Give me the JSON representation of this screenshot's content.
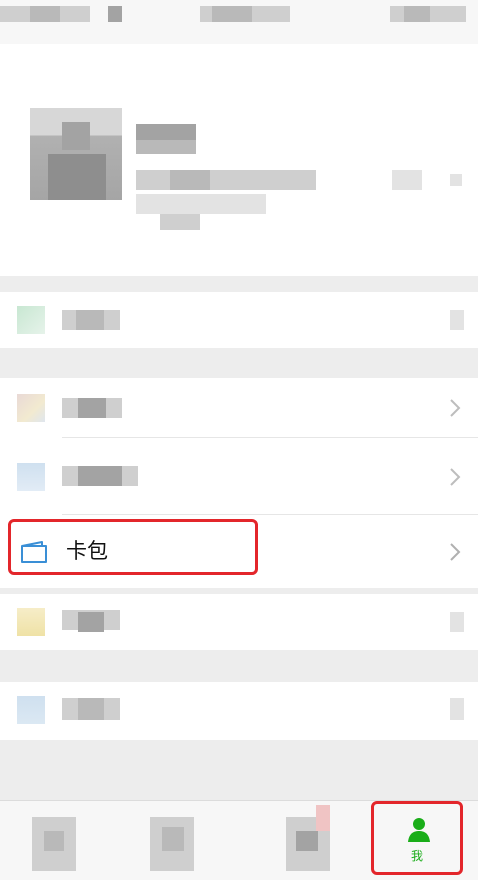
{
  "card_row": {
    "label": "卡包"
  },
  "tabbar": {
    "me_label": "我",
    "active_color": "#1aad19"
  },
  "highlight_color": "#e3262b"
}
